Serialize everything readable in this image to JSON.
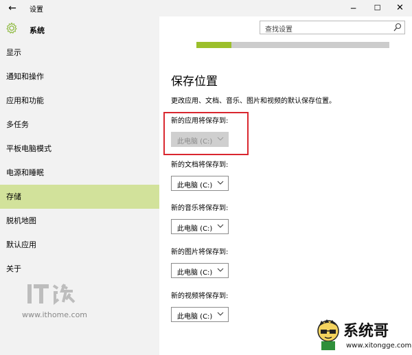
{
  "window": {
    "title": "设置",
    "back_icon": "←",
    "minimize_icon": "−",
    "maximize_icon": "☐",
    "close_icon": "✕"
  },
  "header": {
    "section": "系统",
    "icon": "gear-icon"
  },
  "search": {
    "placeholder": "查找设置",
    "icon": "search-icon"
  },
  "sidebar": {
    "items": [
      {
        "label": "显示",
        "active": false
      },
      {
        "label": "通知和操作",
        "active": false
      },
      {
        "label": "应用和功能",
        "active": false
      },
      {
        "label": "多任务",
        "active": false
      },
      {
        "label": "平板电脑模式",
        "active": false
      },
      {
        "label": "电源和睡眠",
        "active": false
      },
      {
        "label": "存储",
        "active": true
      },
      {
        "label": "脱机地图",
        "active": false
      },
      {
        "label": "默认应用",
        "active": false
      },
      {
        "label": "关于",
        "active": false
      }
    ],
    "active_color": "#d2e29b"
  },
  "storage_bar": {
    "used_fraction": 0.18,
    "fill_color": "#9bbf2b",
    "track_color": "#cccccc"
  },
  "main": {
    "title": "保存位置",
    "description": "更改应用、文档、音乐、图片和视频的默认保存位置。",
    "save_locations": [
      {
        "label": "新的应用将保存到:",
        "value": "此电脑 (C:)",
        "disabled": true,
        "highlighted": true
      },
      {
        "label": "新的文档将保存到:",
        "value": "此电脑 (C:)",
        "disabled": false
      },
      {
        "label": "新的音乐将保存到:",
        "value": "此电脑 (C:)",
        "disabled": false
      },
      {
        "label": "新的图片将保存到:",
        "value": "此电脑 (C:)",
        "disabled": false
      },
      {
        "label": "新的视频将保存到:",
        "value": "此电脑 (C:)",
        "disabled": false
      }
    ],
    "highlight_color": "#d9262e"
  },
  "watermarks": {
    "ithome_logo_text": "IT之家",
    "ithome_url": "www.ithome.com",
    "brand_text": "系统哥",
    "brand_url": "www.xitongge.com"
  }
}
